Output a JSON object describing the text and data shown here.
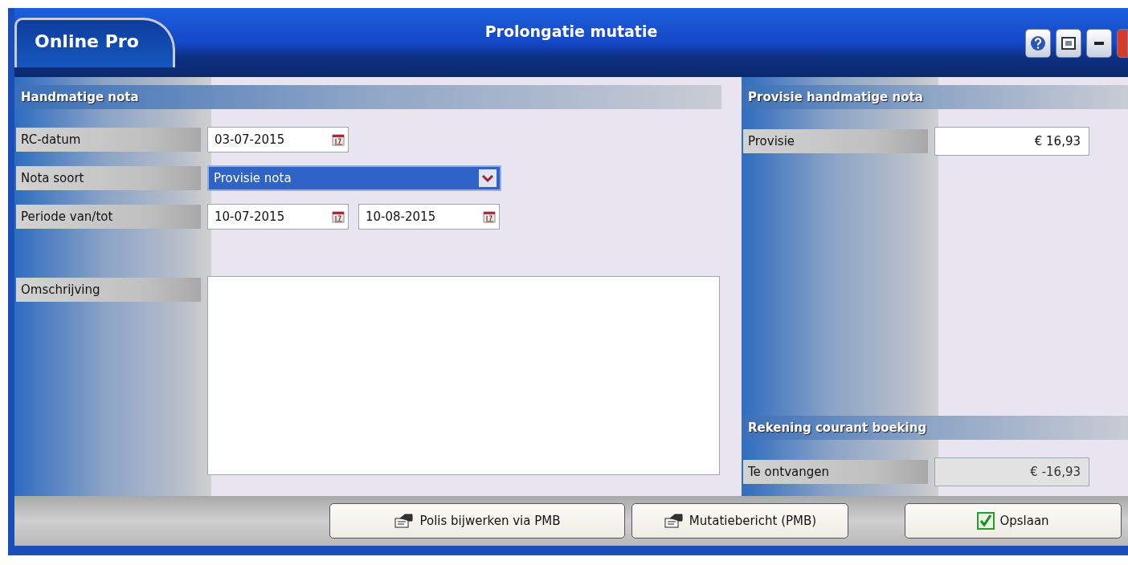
{
  "window": {
    "app_name": "Online Pro",
    "title": "Prolongatie mutatie"
  },
  "left_section": {
    "title": "Handmatige nota",
    "fields": [
      {
        "label": "RC-datum",
        "kind": "date",
        "values": [
          "03-07-2015"
        ]
      },
      {
        "label": "Nota soort",
        "kind": "select",
        "values": [
          "Provisie nota"
        ]
      },
      {
        "label": "Periode van/tot",
        "kind": "date",
        "values": [
          "10-07-2015",
          "10-08-2015"
        ]
      },
      {
        "label": "Omschrijving",
        "kind": "textarea"
      }
    ]
  },
  "right_sections": [
    {
      "title": "Provisie handmatige nota",
      "fields": [
        {
          "label": "Provisie",
          "value": "€ 16,93",
          "disabled": false
        }
      ]
    },
    {
      "title": "Rekening courant boeking",
      "fields": [
        {
          "label": "Te ontvangen",
          "value": "€ -16,93",
          "disabled": true
        }
      ]
    }
  ],
  "buttons": [
    {
      "label": "Polis bijwerken via PMB",
      "kind": "pmb"
    },
    {
      "label": "Mutatiebericht (PMB)",
      "kind": "pmb"
    },
    {
      "label": "Opslaan",
      "kind": "save"
    }
  ]
}
